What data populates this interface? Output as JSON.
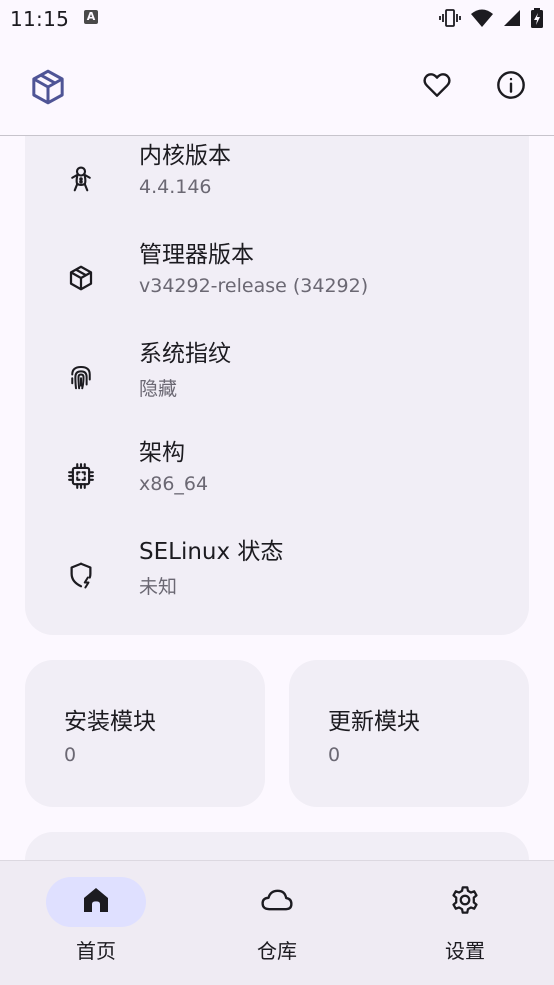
{
  "status_bar": {
    "time": "11:15",
    "notification_badge": "A"
  },
  "app_bar": {
    "logo_icon": "package-cube-icon",
    "actions": [
      {
        "icon": "heart-icon"
      },
      {
        "icon": "info-icon"
      }
    ]
  },
  "info_card": {
    "rows": [
      {
        "icon": "gingerbread-icon",
        "title": "内核版本",
        "value": "4.4.146"
      },
      {
        "icon": "package-icon",
        "title": "管理器版本",
        "value": "v34292-release (34292)"
      },
      {
        "icon": "fingerprint-icon",
        "title": "系统指纹",
        "value": "隐藏"
      },
      {
        "icon": "chip-icon",
        "title": "架构",
        "value": "x86_64"
      },
      {
        "icon": "shield-bolt-icon",
        "title": "SELinux 状态",
        "value": "未知"
      }
    ]
  },
  "modules": {
    "installed": {
      "title": "安装模块",
      "count": "0"
    },
    "updates": {
      "title": "更新模块",
      "count": "0"
    }
  },
  "bottom_nav": {
    "items": [
      {
        "label": "首页",
        "icon": "home-icon",
        "active": true
      },
      {
        "label": "仓库",
        "icon": "cloud-icon",
        "active": false
      },
      {
        "label": "设置",
        "icon": "gear-icon",
        "active": false
      }
    ]
  },
  "colors": {
    "accent": "#4f5596",
    "surface": "#fcf8ff",
    "card": "#f1eef6",
    "nav_active_pill": "#dfe0ff"
  }
}
